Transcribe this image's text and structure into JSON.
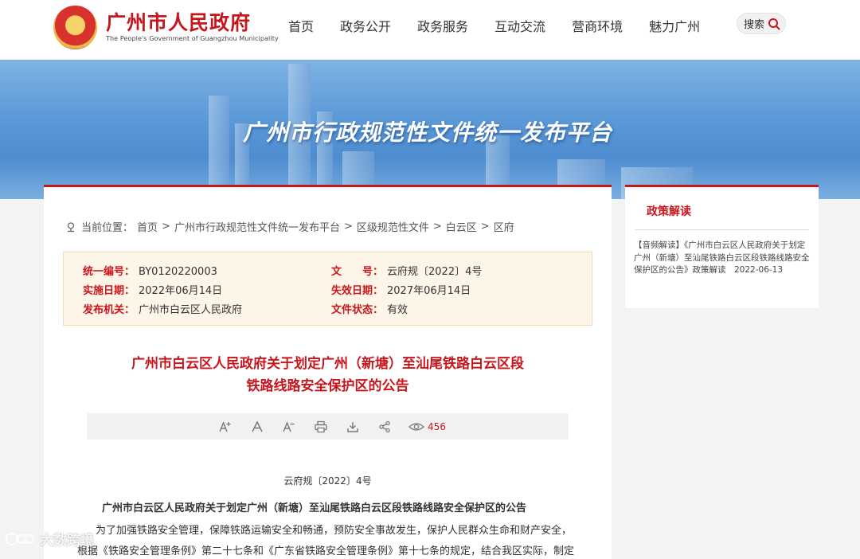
{
  "header": {
    "logo_cn": "广州市人民政府",
    "logo_en": "The People's Government of Guangzhou Municipality",
    "nav": [
      "首页",
      "政务公开",
      "政务服务",
      "互动交流",
      "营商环境",
      "魅力广州"
    ],
    "search_label": "搜索"
  },
  "banner": {
    "title": "广州市行政规范性文件统一发布平台"
  },
  "breadcrumb": {
    "prefix": "当前位置：",
    "items": [
      "首页",
      "广州市行政规范性文件统一发布平台",
      "区级规范性文件",
      "白云区",
      "区府"
    ],
    "sep": ">"
  },
  "meta": {
    "code_label": "统一编号：",
    "code": "BY0120220003",
    "doc_no_label": "文　　号：",
    "doc_no": "云府规〔2022〕4号",
    "effective_label": "实施日期：",
    "effective": "2022年06月14日",
    "expire_label": "失效日期：",
    "expire": "2027年06月14日",
    "issuer_label": "发布机关：",
    "issuer": "广州市白云区人民政府",
    "status_label": "文件状态：",
    "status": "有效"
  },
  "document": {
    "title_line1": "广州市白云区人民政府关于划定广州（新塘）至汕尾铁路白云区段",
    "title_line2": "铁路线路安全保护区的公告",
    "views": "456",
    "number": "云府规〔2022〕4号",
    "heading": "广州市白云区人民政府关于划定广州（新塘）至汕尾铁路白云区段铁路线路安全保护区的公告",
    "para1": "为了加强铁路安全管理，保障铁路运输安全和畅通，预防安全事故发生，保护人民群众生命和财产安全，",
    "para2": "根据《铁路安全管理条例》第二十七条和《广东省铁路安全管理条例》第十七条的规定，结合我区实际，制定"
  },
  "side": {
    "title": "政策解读",
    "item": "【音频解读】《广州市白云区人民政府关于划定广州（新塘）至汕尾铁路白云区段铁路线路安全保护区的公告》政策解读　2022-06-13"
  },
  "watermark": "大数跨境",
  "colors": {
    "brand": "#c8161d",
    "meta_bg": "#fdf6e8",
    "banner": "#5d9ad8"
  }
}
